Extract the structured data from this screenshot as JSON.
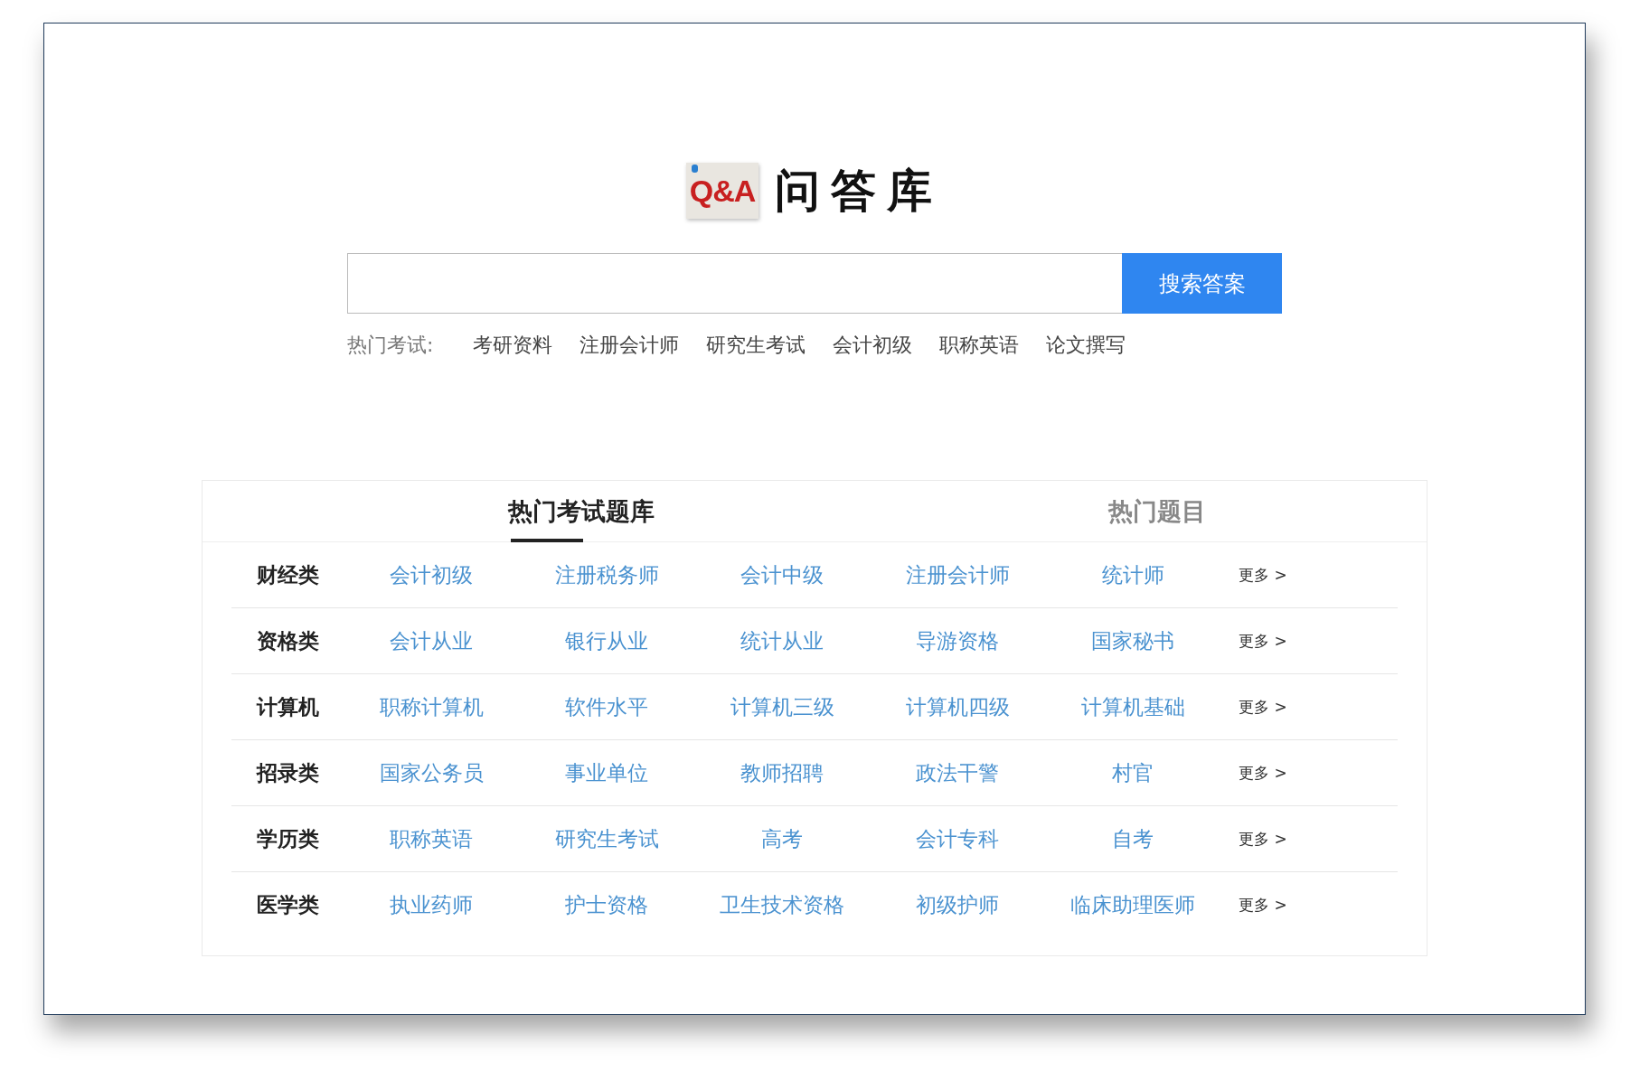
{
  "logo": {
    "badge": "Q&A",
    "title": "问答库"
  },
  "search": {
    "button": "搜索答案"
  },
  "hot_exams": {
    "label": "热门考试:",
    "links": [
      "考研资料",
      "注册会计师",
      "研究生考试",
      "会计初级",
      "职称英语",
      "论文撰写"
    ]
  },
  "tabs": [
    {
      "label": "热门考试题库",
      "selected": true
    },
    {
      "label": "热门题目",
      "selected": false
    }
  ],
  "categories": [
    {
      "name": "财经类",
      "links": [
        "会计初级",
        "注册税务师",
        "会计中级",
        "注册会计师",
        "统计师"
      ],
      "more": "更多 >"
    },
    {
      "name": "资格类",
      "links": [
        "会计从业",
        "银行从业",
        "统计从业",
        "导游资格",
        "国家秘书"
      ],
      "more": "更多 >"
    },
    {
      "name": "计算机",
      "links": [
        "职称计算机",
        "软件水平",
        "计算机三级",
        "计算机四级",
        "计算机基础"
      ],
      "more": "更多 >"
    },
    {
      "name": "招录类",
      "links": [
        "国家公务员",
        "事业单位",
        "教师招聘",
        "政法干警",
        "村官"
      ],
      "more": "更多 >"
    },
    {
      "name": "学历类",
      "links": [
        "职称英语",
        "研究生考试",
        "高考",
        "会计专科",
        "自考"
      ],
      "more": "更多 >"
    },
    {
      "name": "医学类",
      "links": [
        "执业药师",
        "护士资格",
        "卫生技术资格",
        "初级护师",
        "临床助理医师"
      ],
      "more": "更多 >"
    }
  ]
}
